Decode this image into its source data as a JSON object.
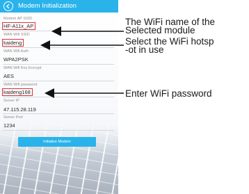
{
  "app": {
    "title": "Modem Initialization",
    "back_icon": "chevron-left-icon",
    "accent_color": "#29b3ea",
    "highlight_color": "#e0303a"
  },
  "form": {
    "fields": [
      {
        "label": "Modem AP SSID",
        "value": "HF-A11x_AP",
        "highlighted": true
      },
      {
        "label": "WAN Wifi SSID",
        "value": "kaideng",
        "highlighted": true
      },
      {
        "label": "WAN Wifi Auth",
        "value": "WPA2PSK",
        "highlighted": false
      },
      {
        "label": "WAN Wifi Key Encrypt",
        "value": "AES",
        "highlighted": false
      },
      {
        "label": "WAN Wifi password",
        "value": "kaideng168",
        "highlighted": true
      },
      {
        "label": "Server IP",
        "value": "47.115.28.119",
        "highlighted": false
      },
      {
        "label": "Server Port",
        "value": "1234",
        "highlighted": false
      }
    ],
    "submit_label": "Initialize Modem"
  },
  "annotations": {
    "module_line1": "The WiFi name of the",
    "module_line2": "Selected module",
    "hotspot_line1": "Select the WiFi hotsp",
    "hotspot_line2": "-ot in use",
    "password": "Enter WiFi password"
  }
}
